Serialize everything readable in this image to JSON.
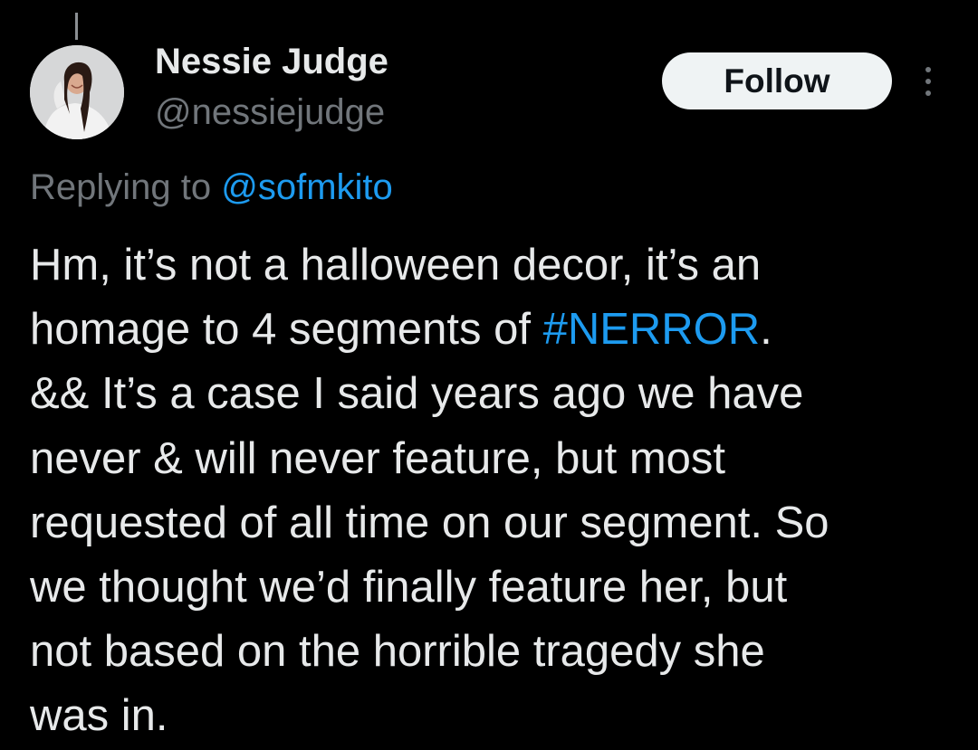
{
  "author": {
    "display_name": "Nessie Judge",
    "handle": "@nessiejudge",
    "avatar_icon": "profile-photo"
  },
  "actions": {
    "follow_label": "Follow",
    "more_icon": "more-vertical-icon"
  },
  "reply_context": {
    "prefix": "Replying to ",
    "mention": "@sofmkito"
  },
  "tweet": {
    "line1": "Hm, it’s not a halloween decor, it’s an",
    "line2_before": "homage to 4 segments of ",
    "line2_hashtag": "#NERROR",
    "line2_after": ".",
    "line3": "&& It’s a case I said years ago we have",
    "line4": "never & will never feature, but most",
    "line5": "requested of all time on our segment. So",
    "line6": "we thought we’d finally feature her, but",
    "line7": "not based on the horrible tragedy she",
    "line8": "was in."
  },
  "colors": {
    "background": "#000000",
    "primary_text": "#e7e9ea",
    "secondary_text": "#71767b",
    "link": "#1d9bf0",
    "follow_button_bg": "#eff3f4"
  }
}
